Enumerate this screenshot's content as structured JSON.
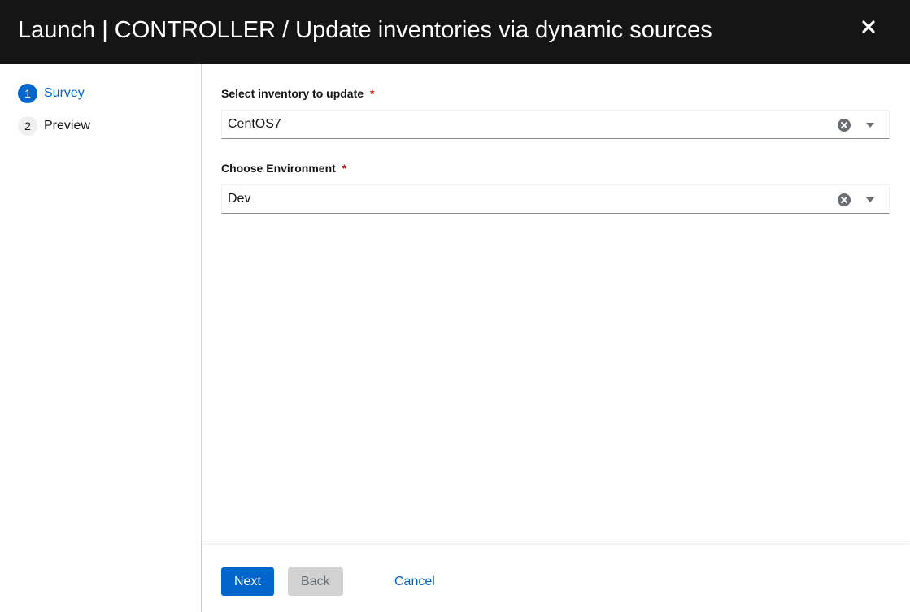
{
  "header": {
    "title": "Launch | CONTROLLER / Update inventories via dynamic sources",
    "close_icon": "close-icon"
  },
  "nav": {
    "steps": [
      {
        "number": "1",
        "label": "Survey",
        "state": "active"
      },
      {
        "number": "2",
        "label": "Preview",
        "state": "inactive"
      }
    ]
  },
  "form": {
    "fields": [
      {
        "label": "Select inventory to update",
        "required_mark": "*",
        "value": "CentOS7"
      },
      {
        "label": "Choose Environment",
        "required_mark": "*",
        "value": "Dev"
      }
    ]
  },
  "footer": {
    "next_label": "Next",
    "back_label": "Back",
    "cancel_label": "Cancel"
  },
  "colors": {
    "header_bg": "#151515",
    "accent": "#0066cc",
    "required": "#c9190b",
    "disabled_bg": "#d2d2d2"
  }
}
